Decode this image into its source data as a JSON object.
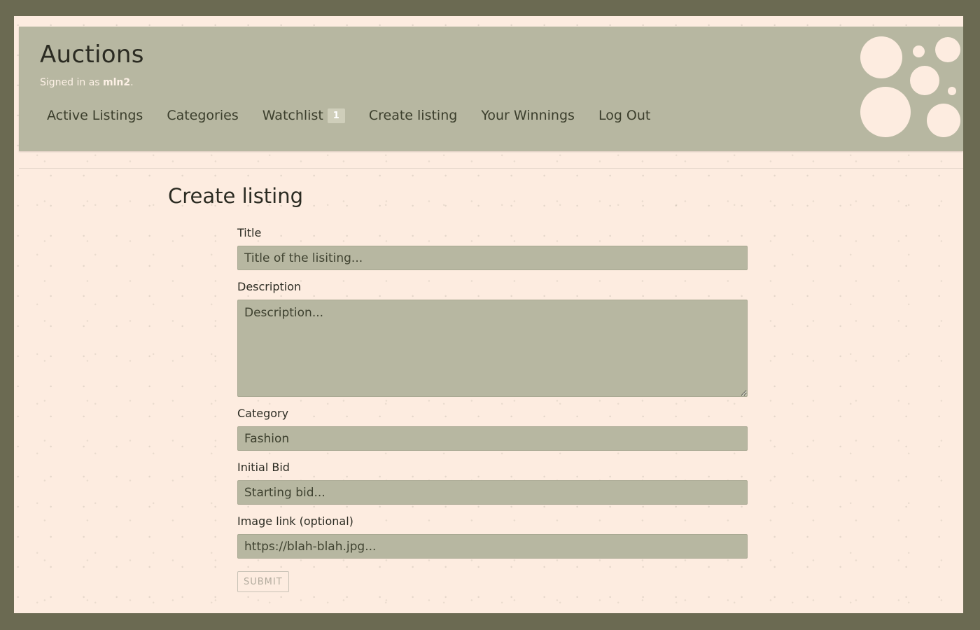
{
  "header": {
    "brand": "Auctions",
    "signed_prefix": "Signed in as",
    "username": "mln2",
    "signed_suffix": "."
  },
  "nav": {
    "active_listings": "Active Listings",
    "categories": "Categories",
    "watchlist": "Watchlist",
    "watchlist_count": "1",
    "create_listing": "Create listing",
    "your_winnings": "Your Winnings",
    "log_out": "Log Out"
  },
  "main": {
    "title": "Create listing",
    "form": {
      "title_label": "Title",
      "title_placeholder": "Title of the lisiting...",
      "description_label": "Description",
      "description_placeholder": "Description...",
      "category_label": "Category",
      "category_value": "Fashion",
      "initial_bid_label": "Initial Bid",
      "initial_bid_placeholder": "Starting bid...",
      "image_label": "Image link (optional)",
      "image_placeholder": "https://blah-blah.jpg...",
      "submit_label": "SUBMIT"
    }
  },
  "colors": {
    "frame": "#6b6a52",
    "page_bg": "#fdece0",
    "header_bg": "#b7b7a1",
    "field_bg": "#b7b7a1",
    "text": "#2b2b22"
  }
}
